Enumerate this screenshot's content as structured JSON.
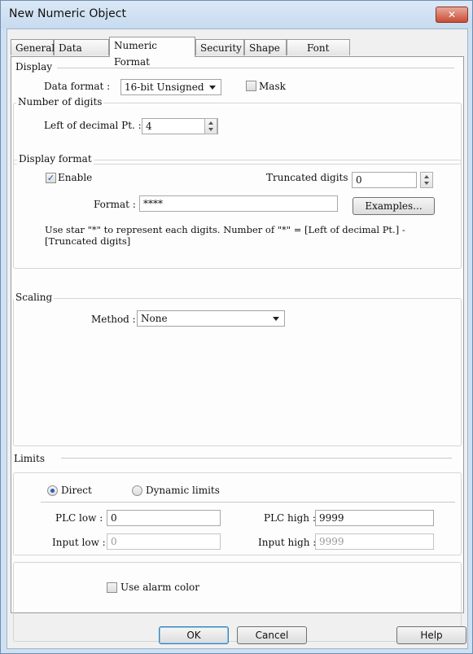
{
  "window": {
    "title": "New Numeric Object",
    "close_glyph": "✕"
  },
  "tabs": [
    {
      "label": "General"
    },
    {
      "label": "Data Entry"
    },
    {
      "label": "Numeric Format",
      "active": true
    },
    {
      "label": "Security"
    },
    {
      "label": "Shape"
    },
    {
      "label": "Font"
    }
  ],
  "display": {
    "group_label": "Display",
    "data_format_label": "Data format :",
    "data_format_value": "16-bit Unsigned",
    "mask_label": "Mask",
    "mask_checked": false
  },
  "digits": {
    "group_label": "Number of digits",
    "left_label": "Left of decimal Pt. :",
    "left_value": "4"
  },
  "display_format": {
    "group_label": "Display format",
    "enable_label": "Enable",
    "enable_checked": true,
    "truncated_label": "Truncated digits :",
    "truncated_value": "0",
    "format_label": "Format :",
    "format_value": "****",
    "examples_button": "Examples...",
    "hint_line1": "Use star \"*\" to represent each digits. Number of \"*\" = [Left of decimal Pt.] -",
    "hint_line2": "[Truncated digits]"
  },
  "scaling": {
    "group_label": "Scaling",
    "method_label": "Method :",
    "method_value": "None"
  },
  "limits": {
    "group_label": "Limits",
    "direct_label": "Direct",
    "direct_selected": true,
    "dynamic_label": "Dynamic limits",
    "plc_low_label": "PLC low :",
    "plc_low_value": "0",
    "plc_high_label": "PLC high :",
    "plc_high_value": "9999",
    "input_low_label": "Input low :",
    "input_low_value": "0",
    "input_high_label": "Input high :",
    "input_high_value": "9999",
    "alarm_label": "Use alarm color",
    "alarm_checked": false
  },
  "footer": {
    "ok": "OK",
    "cancel": "Cancel",
    "help": "Help"
  },
  "colors": {
    "title_bar": "#c7dbef",
    "close_button": "#c94c36",
    "panel": "#fdfdfd",
    "default_button_border": "#3c7fb1"
  }
}
